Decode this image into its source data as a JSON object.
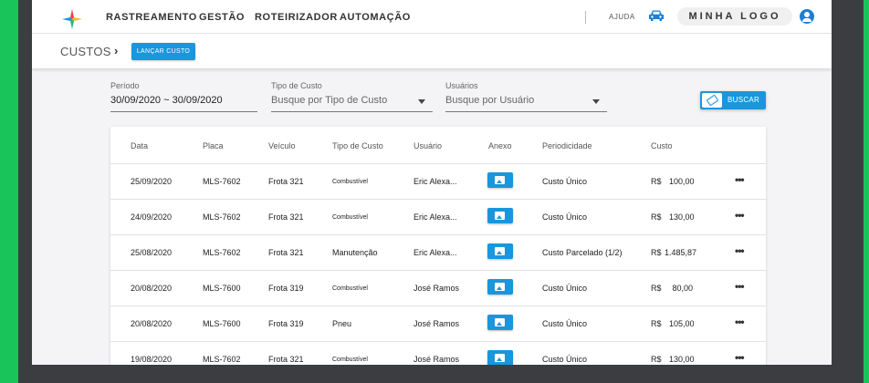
{
  "nav": {
    "items": [
      "RASTREAMENTO",
      "GESTÃO",
      "ROTEIRIZADOR",
      "AUTOMAÇÃO"
    ],
    "help_label": "AJUDA",
    "brand_text": "MINHA LOGO"
  },
  "subheader": {
    "breadcrumb": "CUSTOS",
    "launch_button": "LANÇAR CUSTO"
  },
  "filters": {
    "period_label": "Período",
    "period_value": "30/09/2020 ~ 30/09/2020",
    "cost_type_label": "Tipo de Custo",
    "cost_type_placeholder": "Busque por Tipo de Custo",
    "users_label": "Usuários",
    "users_placeholder": "Busque por Usuário",
    "search_button": "BUSCAR"
  },
  "table": {
    "headers": [
      "Data",
      "Placa",
      "Veículo",
      "Tipo de Custo",
      "Usuário",
      "Anexo",
      "Periodicidade",
      "Custo"
    ],
    "rows": [
      {
        "date": "25/09/2020",
        "plate": "MLS-7602",
        "vehicle": "Frota 321",
        "type": "Combustível",
        "user": "Eric Alexa...",
        "periodicity": "Custo Único",
        "currency": "R$",
        "amount": "100,00"
      },
      {
        "date": "24/09/2020",
        "plate": "MLS-7602",
        "vehicle": "Frota 321",
        "type": "Combustível",
        "user": "Eric Alexa...",
        "periodicity": "Custo Único",
        "currency": "R$",
        "amount": "130,00"
      },
      {
        "date": "25/08/2020",
        "plate": "MLS-7602",
        "vehicle": "Frota 321",
        "type": "Manutenção",
        "user": "Eric Alexa...",
        "periodicity": "Custo Parcelado (1/2)",
        "currency": "R$",
        "amount": "1.485,87"
      },
      {
        "date": "20/08/2020",
        "plate": "MLS-7600",
        "vehicle": "Frota 319",
        "type": "Combustível",
        "user": "José Ramos",
        "periodicity": "Custo Único",
        "currency": "R$",
        "amount": "80,00"
      },
      {
        "date": "20/08/2020",
        "plate": "MLS-7600",
        "vehicle": "Frota 319",
        "type": "Pneu",
        "user": "José Ramos",
        "periodicity": "Custo Único",
        "currency": "R$",
        "amount": "105,00"
      },
      {
        "date": "19/08/2020",
        "plate": "MLS-7602",
        "vehicle": "Frota 321",
        "type": "Combustível",
        "user": "José Ramos",
        "periodicity": "Custo Único",
        "currency": "R$",
        "amount": "130,00"
      }
    ],
    "more_label": "•••"
  },
  "colors": {
    "background": "#19c55a",
    "accent": "#1a96dc",
    "user_icon": "#1a7fd4"
  }
}
